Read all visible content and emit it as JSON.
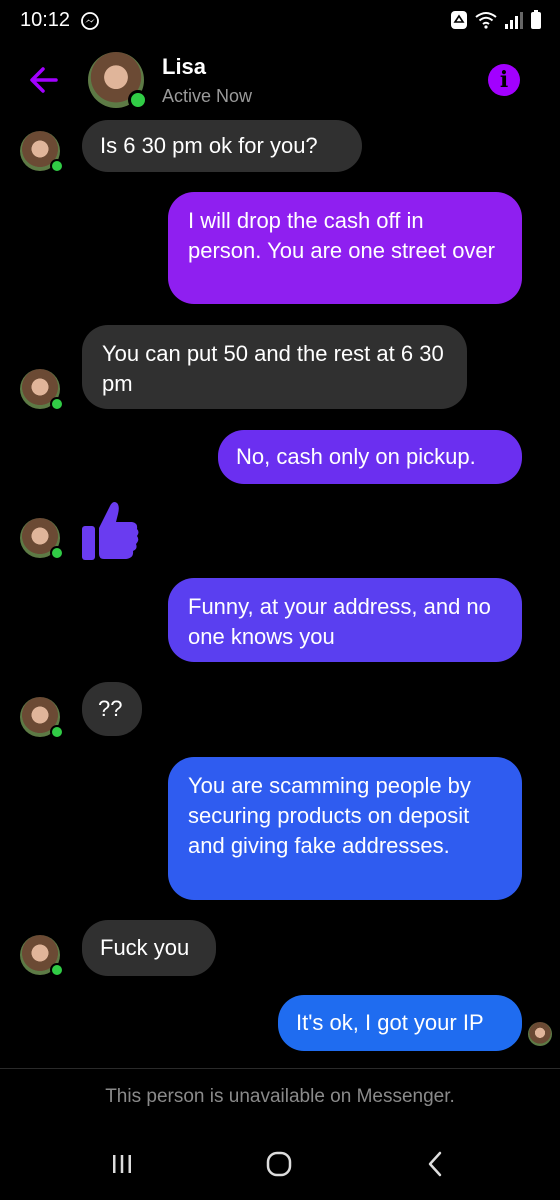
{
  "status_bar": {
    "time": "10:12",
    "icons": [
      "messenger-icon",
      "recycle-icon",
      "wifi-icon",
      "signal-icon",
      "battery-icon"
    ]
  },
  "header": {
    "contact_name": "Lisa",
    "presence": "Active Now",
    "icons": [
      "back-arrow-icon",
      "info-icon"
    ]
  },
  "colors": {
    "accent": "#a200ff",
    "incoming_bubble": "#303030",
    "online": "#31cc46",
    "gradient_top": "#9b1ff0",
    "gradient_bottom": "#1f6cf0"
  },
  "messages": [
    {
      "direction": "incoming",
      "text": "Is 6 30 pm ok for you?"
    },
    {
      "direction": "outgoing",
      "text": "I will drop the cash off in person. You are one street over"
    },
    {
      "direction": "incoming",
      "text": "You can put 50 and the rest  at 6 30 pm"
    },
    {
      "direction": "outgoing",
      "text": "No, cash only on pickup."
    },
    {
      "direction": "incoming",
      "text": "",
      "icon": "thumbs-up-icon"
    },
    {
      "direction": "outgoing",
      "text": "Funny, at your address, and no one knows you"
    },
    {
      "direction": "incoming",
      "text": "??"
    },
    {
      "direction": "outgoing",
      "text": "You are scamming people by securing products on deposit and giving fake addresses."
    },
    {
      "direction": "incoming",
      "text": "Fuck you"
    },
    {
      "direction": "outgoing",
      "text": "It's ok, I got your IP"
    }
  ],
  "footer": {
    "notice": "This person is unavailable on Messenger."
  },
  "nav_bar": {
    "icons": [
      "recent-apps-icon",
      "home-icon",
      "back-icon"
    ]
  }
}
